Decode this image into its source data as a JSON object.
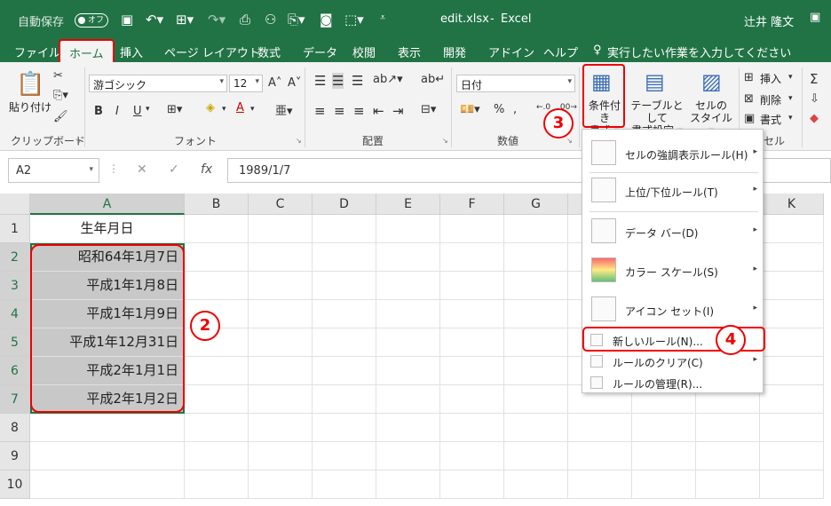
{
  "titlebar": {
    "autosave_label": "自動保存",
    "autosave_state": "オフ",
    "filename": "edit.xlsx",
    "app": "Excel",
    "user": "辻井 隆文"
  },
  "tabs": [
    "ファイル",
    "ホーム",
    "挿入",
    "ページ レイアウト",
    "数式",
    "データ",
    "校閲",
    "表示",
    "開発",
    "アドイン",
    "ヘルプ"
  ],
  "active_tab": "ホーム",
  "tell_me": "実行したい作業を入力してください",
  "ribbon": {
    "clipboard": {
      "paste": "貼り付け",
      "label": "クリップボード"
    },
    "font": {
      "name": "游ゴシック",
      "size": "12",
      "label": "フォント",
      "bold": "B",
      "italic": "I",
      "underline": "U"
    },
    "alignment": {
      "label": "配置"
    },
    "number": {
      "format": "日付",
      "label": "数値",
      "percent": "%"
    },
    "styles": {
      "conditional_line1": "条件付き",
      "conditional_line2": "書式",
      "table_line1": "テーブルとして",
      "table_line2": "書式設定",
      "cell_style_line1": "セルの",
      "cell_style_line2": "スタイル"
    },
    "cells": {
      "insert": "挿入",
      "delete": "削除",
      "format": "書式",
      "label": "セル"
    }
  },
  "formula_bar": {
    "name_box": "A2",
    "fx": "fx",
    "content": "1989/1/7"
  },
  "columns": [
    "A",
    "B",
    "C",
    "D",
    "E",
    "F",
    "G",
    "H",
    "I",
    "J",
    "K"
  ],
  "rows": [
    "1",
    "2",
    "3",
    "4",
    "5",
    "6",
    "7",
    "8",
    "9",
    "10"
  ],
  "cells": {
    "A1": "生年月日",
    "A2": "昭和64年1月7日",
    "A3": "平成1年1月8日",
    "A4": "平成1年1月9日",
    "A5": "平成1年12月31日",
    "A6": "平成2年1月1日",
    "A7": "平成2年1月2日"
  },
  "menu": {
    "items": [
      {
        "label": "セルの強調表示ルール(H)"
      },
      {
        "label": "上位/下位ルール(T)"
      },
      {
        "label": "データ バー(D)"
      },
      {
        "label": "カラー スケール(S)"
      },
      {
        "label": "アイコン セット(I)"
      },
      {
        "label": "新しいルール(N)..."
      },
      {
        "label": "ルールのクリア(C)"
      },
      {
        "label": "ルールの管理(R)..."
      }
    ]
  },
  "callouts": [
    "2",
    "3",
    "4"
  ],
  "colors": {
    "excel_green": "#217346",
    "highlight_red": "#e00000",
    "selection_gray": "#c8c8c8"
  }
}
